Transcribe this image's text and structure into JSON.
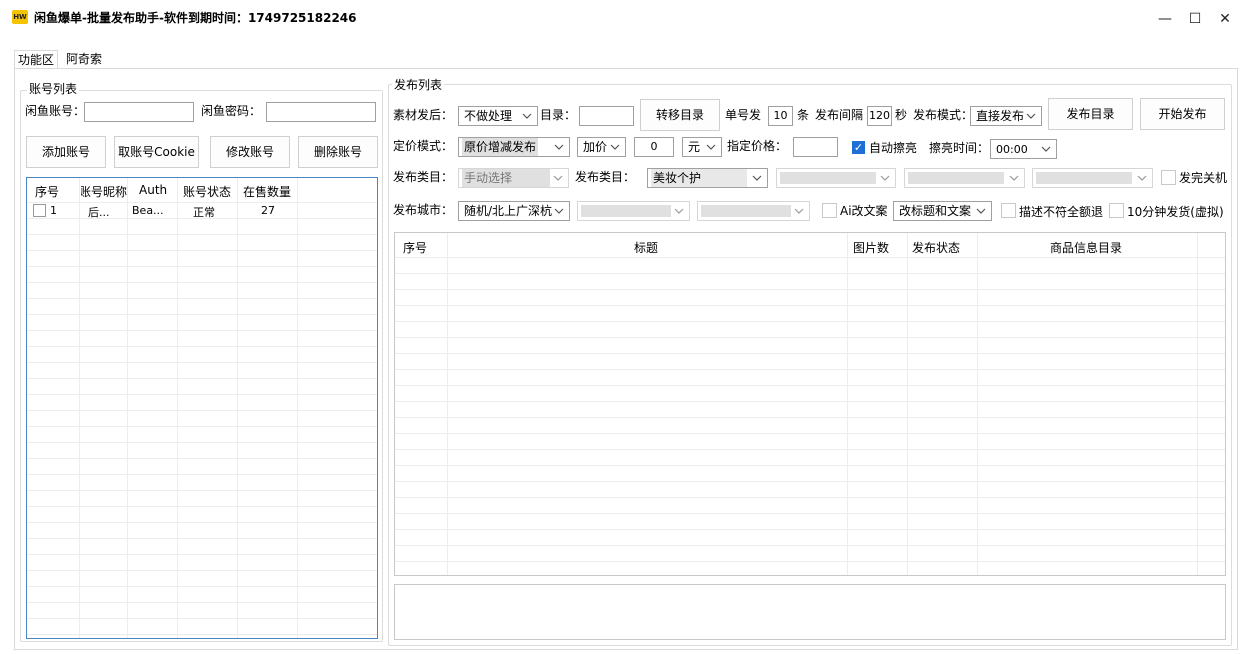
{
  "window": {
    "icon_text": "HW",
    "title": "闲鱼爆单-批量发布助手-软件到期时间：1749725182246",
    "minimize": "—",
    "maximize": "☐",
    "close": "✕"
  },
  "tabs": [
    "功能区",
    "阿奇索"
  ],
  "account_group": {
    "legend": "账号列表",
    "account_label": "闲鱼账号：",
    "account_value": "",
    "password_label": "闲鱼密码：",
    "password_value": "",
    "buttons": {
      "add": "添加账号",
      "cookie": "取账号Cookie",
      "edit": "修改账号",
      "delete": "删除账号"
    },
    "columns": [
      "序号",
      "账号昵称",
      "Auth",
      "账号状态",
      "在售数量"
    ],
    "rows": [
      {
        "index": "1",
        "nickname": "后...",
        "auth": "Bea...",
        "status": "正常",
        "count": "27"
      }
    ]
  },
  "publish_group": {
    "legend": "发布列表",
    "row1": {
      "after_label": "素材发后：",
      "after_value": "不做处理",
      "dir_label": "目录：",
      "dir_value": "",
      "move_button": "转移目录",
      "per_label": "单号发",
      "per_value": "10",
      "per_unit": "条",
      "interval_label": "发布间隔",
      "interval_value": "120",
      "interval_unit": "秒",
      "mode_label": "发布模式：",
      "mode_value": "直接发布",
      "publish_dir_button": "发布目录",
      "start_button": "开始发布"
    },
    "row2": {
      "price_label": "定价模式：",
      "price_mode": "原价增减发布",
      "adjust": "加价",
      "amount": "0",
      "unit": "元",
      "fixed_label": "指定价格：",
      "fixed_value": "",
      "auto_polish": "自动擦亮",
      "auto_polish_checked": true,
      "polish_time_label": "擦亮时间：",
      "polish_time": "00:00"
    },
    "row3": {
      "cat_label": "发布类目：",
      "cat_value": "手动选择",
      "cat2_label": "发布类目：",
      "cat2_value": "美妆个护",
      "shutdown": "发完关机"
    },
    "row4": {
      "city_label": "发布城市：",
      "city_value": "随机/北上广深杭",
      "ai_copy": "Ai改文案",
      "ai_mode": "改标题和文案",
      "desc_skip": "描述不符全额退",
      "ten_min": "10分钟发货(虚拟)"
    },
    "columns": [
      "序号",
      "标题",
      "图片数",
      "发布状态",
      "商品信息目录"
    ]
  }
}
